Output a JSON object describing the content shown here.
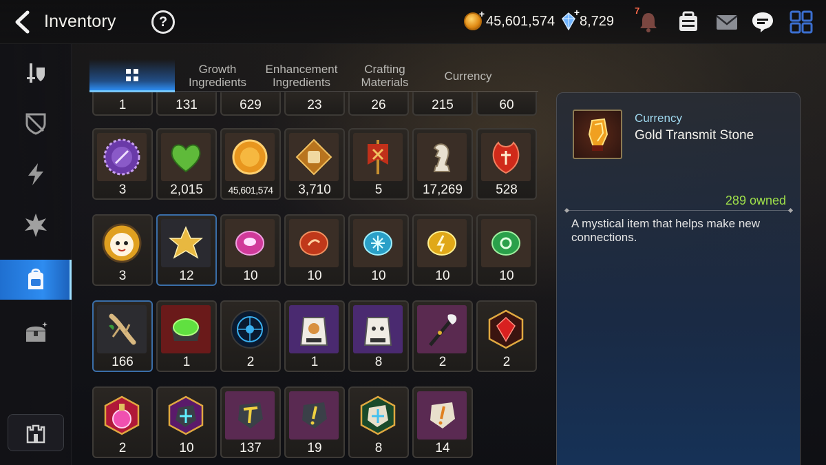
{
  "header": {
    "title": "Inventory",
    "help_label": "?",
    "gold_amount": "45,601,574",
    "crystal_amount": "8,729",
    "notification_count": "7"
  },
  "tabs": [
    {
      "label": "",
      "active": true
    },
    {
      "label": "Growth Ingredients",
      "active": false
    },
    {
      "label": "Enhancement Ingredients",
      "active": false
    },
    {
      "label": "Crafting Materials",
      "active": false
    },
    {
      "label": "Currency",
      "active": false
    }
  ],
  "sidebar": {
    "items": [
      {
        "icon": "gear-armor-icon",
        "active": false
      },
      {
        "icon": "broken-shield-icon",
        "active": false
      },
      {
        "icon": "lightning-icon",
        "active": false
      },
      {
        "icon": "burst-icon",
        "active": false
      },
      {
        "icon": "backpack-icon",
        "active": true
      },
      {
        "icon": "treasure-chest-icon",
        "active": false
      }
    ],
    "home_icon": "castle-icon"
  },
  "inventory": {
    "row0": [
      "1",
      "131",
      "629",
      "23",
      "26",
      "215",
      "60"
    ],
    "row1": [
      "3",
      "2,015",
      "45,601,574",
      "3,710",
      "5",
      "17,269",
      "528"
    ],
    "row2": [
      "3",
      "12",
      "10",
      "10",
      "10",
      "10",
      "10"
    ],
    "row3": [
      "166",
      "1",
      "2",
      "1",
      "8",
      "2",
      "2"
    ],
    "row4": [
      "2",
      "10",
      "137",
      "19",
      "8",
      "14"
    ]
  },
  "detail": {
    "category": "Currency",
    "name": "Gold Transmit Stone",
    "owned": "289 owned",
    "description": "A mystical item that helps make new connections."
  },
  "colors": {
    "accent_blue": "#2d8cf0",
    "owned_green": "#9fe04a",
    "category_cyan": "#9fd8ee"
  }
}
